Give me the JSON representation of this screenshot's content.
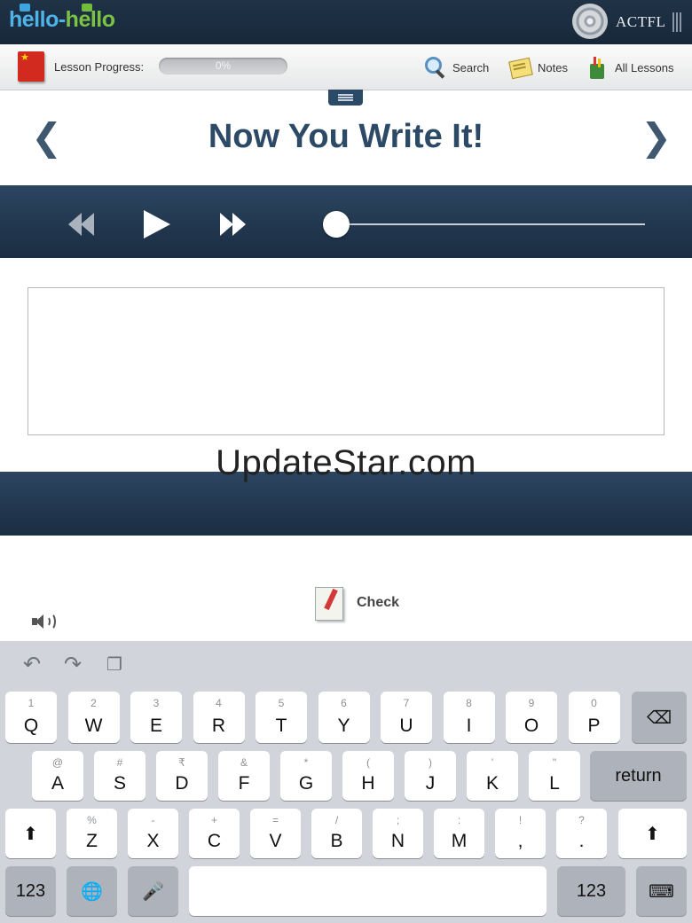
{
  "brand": {
    "logo_part1": "hello",
    "logo_dash": "-",
    "logo_part2": "hello",
    "partner": "ACTFL"
  },
  "lesson": {
    "progress_label": "Lesson Progress:",
    "progress_text": "0%",
    "progress_value": 0
  },
  "toolbar": {
    "search_label": "Search",
    "notes_label": "Notes",
    "all_lessons_label": "All Lessons"
  },
  "activity": {
    "title": "Now You Write It!",
    "prev_glyph": "❮",
    "next_glyph": "❯"
  },
  "player": {
    "position": 0
  },
  "answer": {
    "value": "",
    "placeholder": ""
  },
  "watermark": "UpdateStar.com",
  "check_label": "Check",
  "keyboard": {
    "row1": [
      {
        "sub": "1",
        "main": "Q"
      },
      {
        "sub": "2",
        "main": "W"
      },
      {
        "sub": "3",
        "main": "E"
      },
      {
        "sub": "4",
        "main": "R"
      },
      {
        "sub": "5",
        "main": "T"
      },
      {
        "sub": "6",
        "main": "Y"
      },
      {
        "sub": "7",
        "main": "U"
      },
      {
        "sub": "8",
        "main": "I"
      },
      {
        "sub": "9",
        "main": "O"
      },
      {
        "sub": "0",
        "main": "P"
      }
    ],
    "row2": [
      {
        "sub": "@",
        "main": "A"
      },
      {
        "sub": "#",
        "main": "S"
      },
      {
        "sub": "₹",
        "main": "D"
      },
      {
        "sub": "&",
        "main": "F"
      },
      {
        "sub": "*",
        "main": "G"
      },
      {
        "sub": "(",
        "main": "H"
      },
      {
        "sub": ")",
        "main": "J"
      },
      {
        "sub": "'",
        "main": "K"
      },
      {
        "sub": "\"",
        "main": "L"
      }
    ],
    "row3": [
      {
        "sub": "%",
        "main": "Z"
      },
      {
        "sub": "-",
        "main": "X"
      },
      {
        "sub": "+",
        "main": "C"
      },
      {
        "sub": "=",
        "main": "V"
      },
      {
        "sub": "/",
        "main": "B"
      },
      {
        "sub": ";",
        "main": "N"
      },
      {
        "sub": ":",
        "main": "M"
      },
      {
        "sub": "!",
        "main": ","
      },
      {
        "sub": "?",
        "main": "."
      }
    ],
    "return_label": "return",
    "numbers_label": "123",
    "backspace_glyph": "⌫",
    "shift_glyph": "⬆",
    "globe_glyph": "🌐",
    "mic_glyph": "🎤",
    "undo_glyph": "↶",
    "redo_glyph": "↷",
    "paste_glyph": "❐",
    "hide_glyph": "⌨"
  }
}
